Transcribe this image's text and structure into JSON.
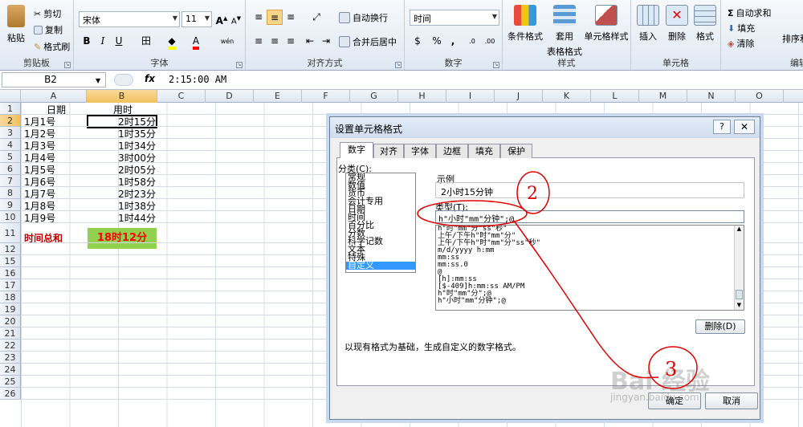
{
  "ribbon": {
    "clipboard": {
      "paste": "粘贴",
      "cut": "剪切",
      "copy": "复制",
      "format_painter": "格式刷",
      "label": "剪贴板"
    },
    "font": {
      "name": "宋体",
      "size": "11",
      "grow": "A",
      "shrink": "A",
      "bold": "B",
      "italic": "I",
      "underline": "U",
      "border": "田",
      "fill": "A",
      "color": "A",
      "wen": "wén",
      "label": "字体"
    },
    "alignment": {
      "wrap": "自动换行",
      "merge": "合并后居中",
      "label": "对齐方式"
    },
    "number": {
      "format": "时间",
      "currency": "$",
      "percent": "%",
      "comma": ",",
      "inc": ".0",
      "dec": ".00",
      "label": "数字"
    },
    "styles": {
      "conditional": "条件格式",
      "table1": "套用",
      "table2": "表格格式",
      "cell": "单元格样式",
      "label": "样式"
    },
    "cells": {
      "insert": "插入",
      "delete": "删除",
      "format": "格式",
      "label": "单元格"
    },
    "editing": {
      "autosum": "自动求和",
      "fill": "填充",
      "clear": "清除",
      "sort": "排序和",
      "label": "编辑"
    }
  },
  "formula_bar": {
    "name_box": "B2",
    "fx": "fx",
    "value": "2:15:00 AM"
  },
  "sheet": {
    "columns": [
      "A",
      "B",
      "C",
      "D",
      "E",
      "F",
      "G",
      "H",
      "I",
      "J",
      "K",
      "L",
      "M",
      "N",
      "O"
    ],
    "selected_col": "B",
    "rows": [
      "1",
      "2",
      "3",
      "4",
      "5",
      "6",
      "7",
      "8",
      "9",
      "10",
      "11",
      "12",
      "15",
      "16",
      "17",
      "18",
      "19",
      "20",
      "21",
      "22",
      "23",
      "24",
      "25",
      "26"
    ],
    "selected_row": "2",
    "header_a": "日期",
    "header_b": "用时",
    "data": [
      {
        "a": "1月1号",
        "b": "2时15分"
      },
      {
        "a": "1月2号",
        "b": "1时35分"
      },
      {
        "a": "1月3号",
        "b": "1时34分"
      },
      {
        "a": "1月4号",
        "b": "3时00分"
      },
      {
        "a": "1月5号",
        "b": "2时05分"
      },
      {
        "a": "1月6号",
        "b": "1时58分"
      },
      {
        "a": "1月7号",
        "b": "2时23分"
      },
      {
        "a": "1月8号",
        "b": "1时38分"
      },
      {
        "a": "1月9号",
        "b": "1时44分"
      }
    ],
    "total_label": "时间总和",
    "total_value": "18时12分"
  },
  "dialog": {
    "title": "设置单元格格式",
    "help": "?",
    "close": "✕",
    "tabs": [
      "数字",
      "对齐",
      "字体",
      "边框",
      "填充",
      "保护"
    ],
    "category_label": "分类(C):",
    "categories": [
      "常规",
      "数值",
      "货币",
      "会计专用",
      "日期",
      "时间",
      "百分比",
      "分数",
      "科学记数",
      "文本",
      "特殊",
      "自定义"
    ],
    "selected_category": "自定义",
    "sample_label": "示例",
    "sample_value": "2小时15分钟",
    "type_label": "类型(T):",
    "type_value": "h\"小时\"mm\"分钟\";@",
    "formats": [
      "h\"时\"mm\"分\"ss\"秒\"",
      "上午/下午h\"时\"mm\"分\"",
      "上午/下午h\"时\"mm\"分\"ss\"秒\"",
      "m/d/yyyy h:mm",
      "mm:ss",
      "mm:ss.0",
      "@",
      "[h]:mm:ss",
      "[$-409]h:mm:ss AM/PM",
      "h\"时\"mm\"分\";@",
      "h\"小时\"mm\"分钟\";@"
    ],
    "delete": "删除(D)",
    "description": "以现有格式为基础，生成自定义的数字格式。",
    "ok": "确定",
    "cancel": "取消"
  },
  "watermark": {
    "logo": "Bai 经验",
    "url": "jingyan.baidu.com"
  },
  "annotations": {
    "mark1": "2",
    "mark2": "3"
  }
}
